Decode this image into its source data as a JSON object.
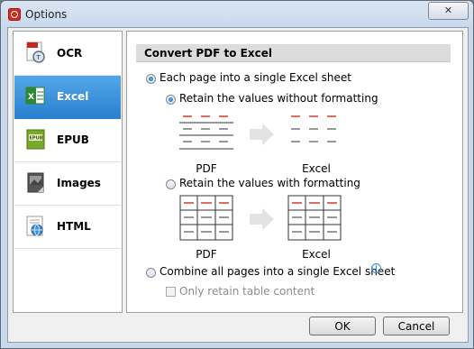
{
  "window": {
    "title": "Options"
  },
  "sidebar": {
    "items": [
      {
        "label": "OCR",
        "icon": "ocr-icon",
        "selected": false
      },
      {
        "label": "Excel",
        "icon": "excel-icon",
        "selected": true
      },
      {
        "label": "EPUB",
        "icon": "epub-icon",
        "selected": false
      },
      {
        "label": "Images",
        "icon": "images-icon",
        "selected": false
      },
      {
        "label": "HTML",
        "icon": "html-icon",
        "selected": false
      }
    ]
  },
  "panel": {
    "heading": "Convert PDF to Excel",
    "option_each_page": "Each page into a single Excel sheet",
    "option_without_formatting": "Retain the values without formatting",
    "option_with_formatting": "Retain the values with formatting",
    "option_combine": "Combine all pages into a single Excel sheet",
    "option_table_only": "Only retain table content",
    "caption_pdf": "PDF",
    "caption_excel": "Excel"
  },
  "buttons": {
    "ok": "OK",
    "cancel": "Cancel"
  },
  "colors": {
    "accent": "#2a7fcf",
    "red_line": "#d23a2a"
  }
}
